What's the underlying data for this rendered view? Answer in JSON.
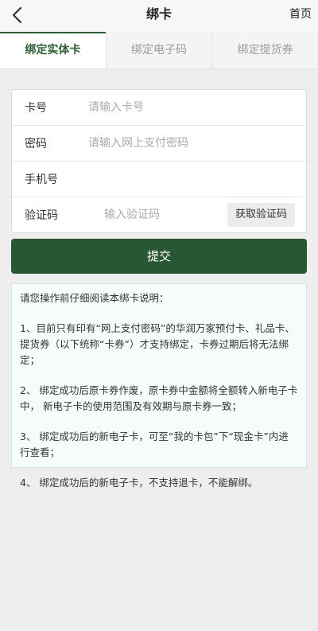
{
  "header": {
    "back_icon": "chevron-left-icon",
    "title": "绑卡",
    "home_label": "首页"
  },
  "tabs": [
    {
      "label": "绑定实体卡",
      "active": true
    },
    {
      "label": "绑定电子码",
      "active": false
    },
    {
      "label": "绑定提货券",
      "active": false
    }
  ],
  "form": {
    "card_no": {
      "label": "卡号",
      "placeholder": "请输入卡号"
    },
    "password": {
      "label": "密码",
      "placeholder": "请输入网上支付密码"
    },
    "phone": {
      "label": "手机号",
      "placeholder": ""
    },
    "verify": {
      "label": "验证码",
      "placeholder": "输入验证码",
      "button": "获取验证码"
    }
  },
  "submit_label": "提交",
  "notice": {
    "intro": "请您操作前仔细阅读本绑卡说明：",
    "items": [
      "1、目前只有印有“网上支付密码”的华润万家预付卡、礼品卡、提货券（以下统称“卡券”）才支持绑定，卡券过期后将无法绑定；",
      "2、 绑定成功后原卡券作废，原卡券中金额将全额转入新电子卡中， 新电子卡的使用范围及有效期与原卡券一致；",
      "3、 绑定成功后的新电子卡，可至“我的卡包”下“现金卡”内进行查看；",
      "4、 绑定成功后的新电子卡，不支持退卡，不能解绑。"
    ]
  },
  "colors": {
    "brand_green": "#2a5733",
    "active_tab_text": "#2d5e36",
    "notice_bg": "#f6fcfc",
    "page_bg": "#eeeeee"
  }
}
